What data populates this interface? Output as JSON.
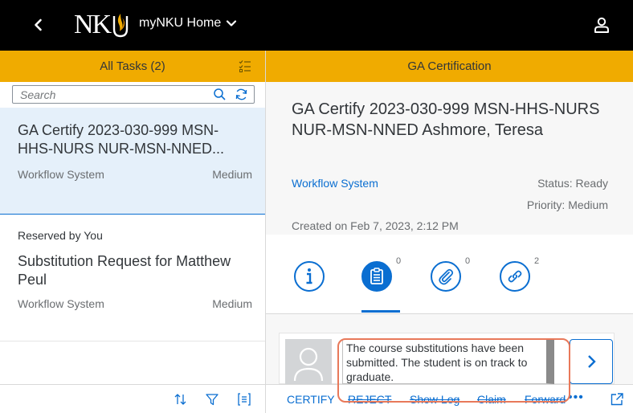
{
  "shell": {
    "logo_text": "NKU",
    "app_title": "myNKU Home",
    "colors": {
      "shell_bg": "#000000",
      "logo_gold": "#f0ab00"
    }
  },
  "master": {
    "header_title": "All Tasks (2)",
    "search_placeholder": "Search",
    "items": [
      {
        "title": "GA Certify 2023-030-999 MSN-HHS-NURS NUR-MSN-NNED...",
        "system": "Workflow System",
        "priority": "Medium"
      },
      {
        "pre_label": "Reserved by You",
        "title": "Substitution Request for Matthew Peul",
        "system": "Workflow System",
        "priority": "Medium"
      }
    ]
  },
  "detail": {
    "header_title": "GA Certification",
    "task_title": "GA Certify 2023-030-999 MSN-HHS-NURS NUR-MSN-NNED Ashmore, Teresa",
    "system_link": "Workflow System",
    "status": "Status: Ready",
    "priority": "Priority: Medium",
    "created": "Created on Feb 7, 2023, 2:12 PM",
    "tabs": [
      {
        "icon": "info-icon",
        "count": ""
      },
      {
        "icon": "notes-icon",
        "count": "0"
      },
      {
        "icon": "attachment-icon",
        "count": "0"
      },
      {
        "icon": "link-icon",
        "count": "2"
      }
    ],
    "comment_text": "The course substitutions have been submitted.  The student is on track to graduate.",
    "footer": {
      "certify": "CERTIFY",
      "reject": "REJECT",
      "show_log": "Show Log",
      "claim": "Claim",
      "forward": "Forward",
      "more": "•••"
    }
  },
  "colors": {
    "accent": "#0a6ed1",
    "header_bar": "#f0ab00",
    "highlight": "#e8795a"
  }
}
